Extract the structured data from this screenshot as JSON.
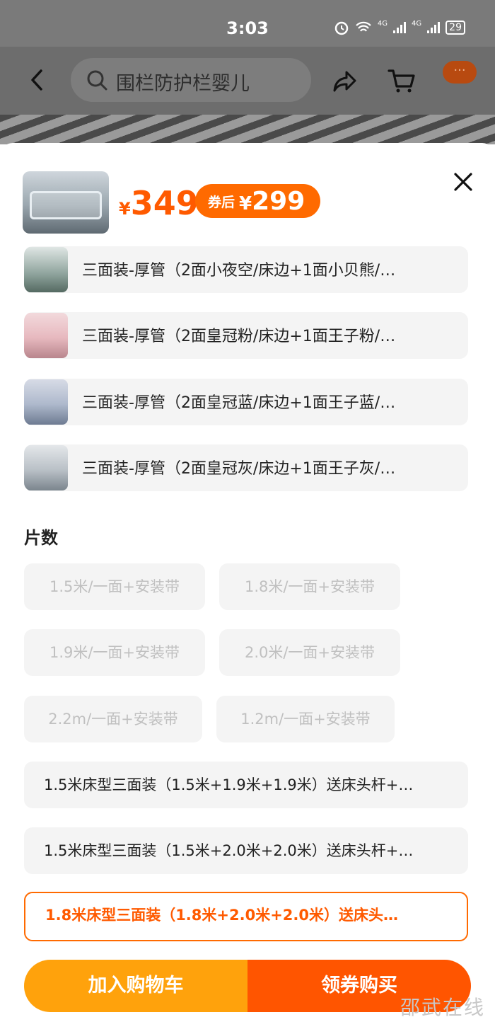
{
  "status_bar": {
    "time": "3:03",
    "signal_1": "4G",
    "signal_2": "4G",
    "battery": "29"
  },
  "header": {
    "search_placeholder": "围栏防护栏婴儿",
    "more_label": "···"
  },
  "product": {
    "currency": "¥",
    "price": "349",
    "coupon_tag": "券后",
    "coupon_currency": "¥",
    "coupon_price": "299"
  },
  "variants": [
    {
      "label": "三面装-厚管（2面小夜空/床边+1面小贝熊/…"
    },
    {
      "label": "三面装-厚管（2面皇冠粉/床边+1面王子粉/…"
    },
    {
      "label": "三面装-厚管（2面皇冠蓝/床边+1面王子蓝/…"
    },
    {
      "label": "三面装-厚管（2面皇冠灰/床边+1面王子灰/…"
    }
  ],
  "pieces": {
    "title": "片数",
    "options": [
      {
        "label": "1.5米/一面+安装带",
        "state": "disabled"
      },
      {
        "label": "1.8米/一面+安装带",
        "state": "disabled"
      },
      {
        "label": "1.9米/一面+安装带",
        "state": "disabled"
      },
      {
        "label": "2.0米/一面+安装带",
        "state": "disabled"
      },
      {
        "label": "2.2m/一面+安装带",
        "state": "disabled"
      },
      {
        "label": "1.2m/一面+安装带",
        "state": "disabled"
      },
      {
        "label": "1.5米床型三面装（1.5米+1.9米+1.9米）送床头杆+…",
        "state": "available"
      },
      {
        "label": "1.5米床型三面装（1.5米+2.0米+2.0米）送床头杆+…",
        "state": "available"
      },
      {
        "label": "1.8米床型三面装（1.8米+2.0米+2.0米）送床头…",
        "state": "selected"
      }
    ]
  },
  "actions": {
    "add_to_cart": "加入购物车",
    "buy_with_coupon": "领券购买"
  },
  "watermark": "邵武在线",
  "colors": {
    "accent": "#ff6a00",
    "add_cart": "#ffa20c",
    "buy": "#ff5500"
  }
}
